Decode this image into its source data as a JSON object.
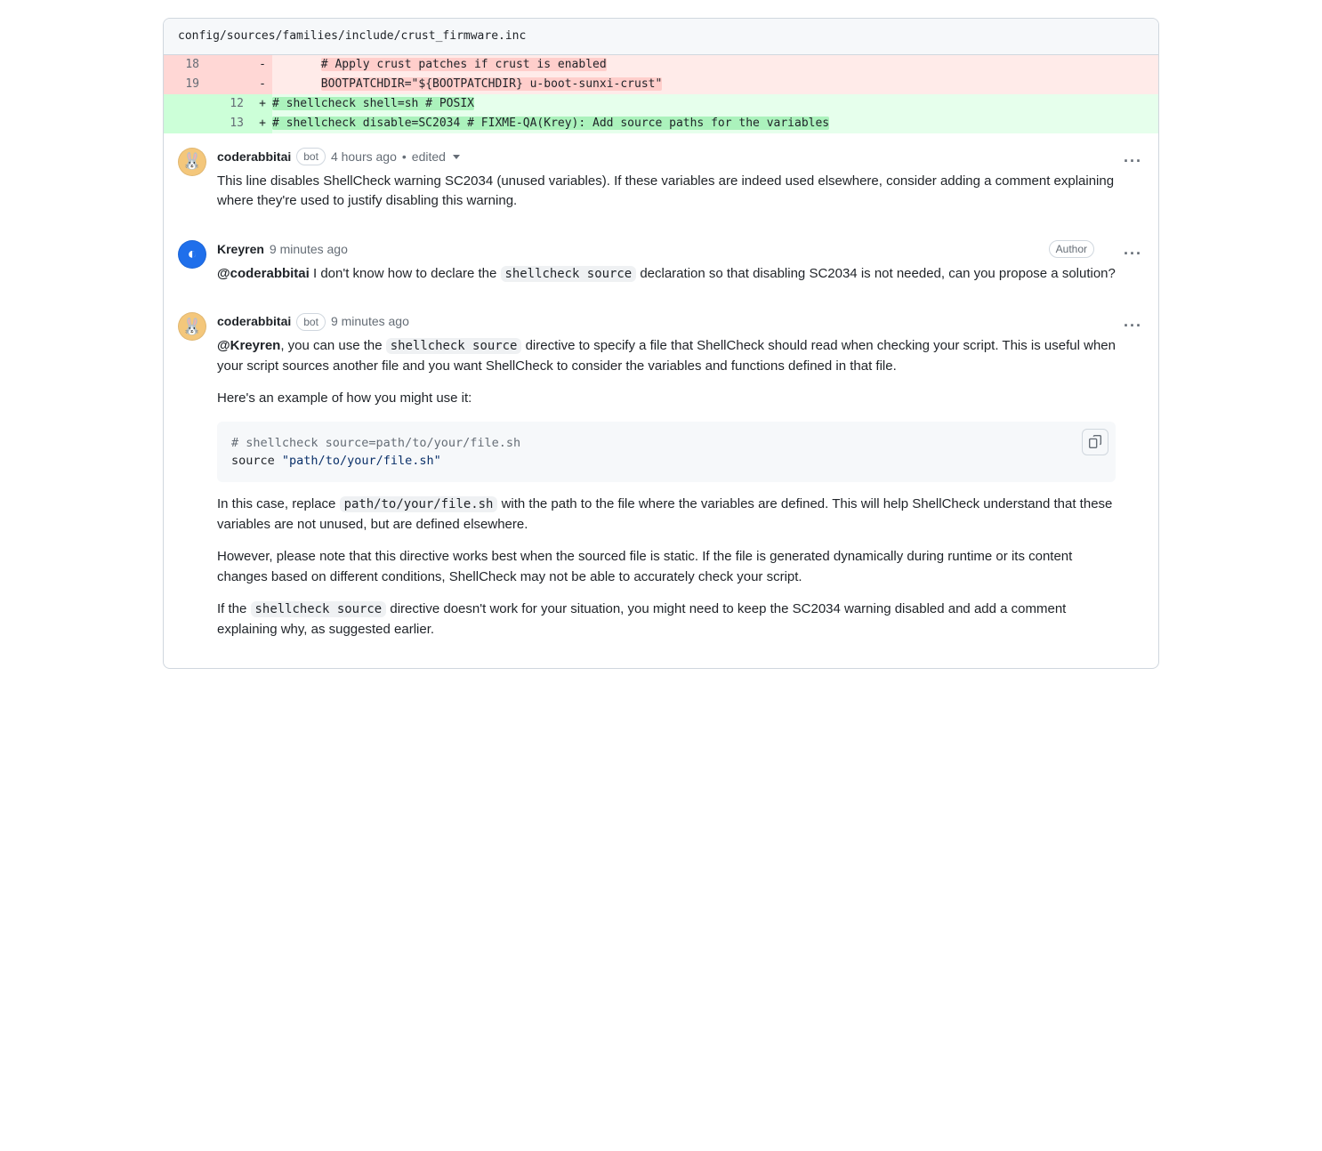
{
  "file_path": "config/sources/families/include/crust_firmware.inc",
  "diff": {
    "rows": [
      {
        "old": "18",
        "new": "",
        "mark": "-",
        "type": "del",
        "plain": "       ",
        "hl": "# Apply crust patches if crust is enabled"
      },
      {
        "old": "19",
        "new": "",
        "mark": "-",
        "type": "del",
        "plain": "       ",
        "hl": "BOOTPATCHDIR=\"${BOOTPATCHDIR} u-boot-sunxi-crust\""
      },
      {
        "old": "",
        "new": "12",
        "mark": "+",
        "type": "add",
        "plain": "",
        "hl": "# shellcheck shell=sh # POSIX"
      },
      {
        "old": "",
        "new": "13",
        "mark": "+",
        "type": "add",
        "plain": "",
        "hl": "# shellcheck disable=SC2034 # FIXME-QA(Krey): Add source paths for the variables"
      }
    ]
  },
  "comments": [
    {
      "author": "coderabbitai",
      "badge": "bot",
      "avatar": "rabbit",
      "time": "4 hours ago",
      "edited": "edited",
      "body_parts": [
        {
          "t": "text",
          "v": "This line disables ShellCheck warning SC2034 (unused variables). If these variables are indeed used elsewhere, consider adding a comment explaining where they're used to justify disabling this warning."
        }
      ]
    },
    {
      "author": "Kreyren",
      "badge": "",
      "avatar": "user",
      "time": "9 minutes ago",
      "right_label": "Author",
      "body_parts": [
        {
          "t": "mention",
          "v": "@coderabbitai"
        },
        {
          "t": "text",
          "v": " I don't know how to declare the "
        },
        {
          "t": "code",
          "v": "shellcheck source"
        },
        {
          "t": "text",
          "v": " declaration so that disabling SC2034 is not needed, can you propose a solution?"
        }
      ]
    },
    {
      "author": "coderabbitai",
      "badge": "bot",
      "avatar": "rabbit",
      "time": "9 minutes ago",
      "paragraphs": [
        [
          {
            "t": "mention",
            "v": "@Kreyren"
          },
          {
            "t": "text",
            "v": ", you can use the "
          },
          {
            "t": "code",
            "v": "shellcheck source"
          },
          {
            "t": "text",
            "v": " directive to specify a file that ShellCheck should read when checking your script. This is useful when your script sources another file and you want ShellCheck to consider the variables and functions defined in that file."
          }
        ],
        [
          {
            "t": "text",
            "v": "Here's an example of how you might use it:"
          }
        ]
      ],
      "codeblock": {
        "line1_comment": "# shellcheck source=path/to/your/file.sh",
        "line2_kw": "source",
        "line2_str": "\"path/to/your/file.sh\""
      },
      "paragraphs_after": [
        [
          {
            "t": "text",
            "v": "In this case, replace "
          },
          {
            "t": "code",
            "v": "path/to/your/file.sh"
          },
          {
            "t": "text",
            "v": " with the path to the file where the variables are defined. This will help ShellCheck understand that these variables are not unused, but are defined elsewhere."
          }
        ],
        [
          {
            "t": "text",
            "v": "However, please note that this directive works best when the sourced file is static. If the file is generated dynamically during runtime or its content changes based on different conditions, ShellCheck may not be able to accurately check your script."
          }
        ],
        [
          {
            "t": "text",
            "v": "If the "
          },
          {
            "t": "code",
            "v": "shellcheck source"
          },
          {
            "t": "text",
            "v": " directive doesn't work for your situation, you might need to keep the SC2034 warning disabled and add a comment explaining why, as suggested earlier."
          }
        ]
      ]
    }
  ]
}
